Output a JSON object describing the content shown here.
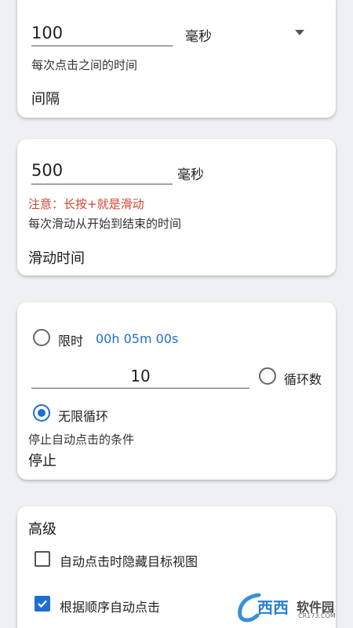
{
  "colors": {
    "accent": "#1e6fd0",
    "warning": "#d2452f",
    "background": "#eef0f4",
    "card": "#ffffff"
  },
  "interval": {
    "value": "100",
    "unit": "毫秒",
    "hint": "每次点击之间的时间",
    "title": "间隔"
  },
  "swipe": {
    "value": "500",
    "unit": "毫秒",
    "warning": "注意：长按+就是滑动",
    "hint": "每次滑动从开始到结束的时间",
    "title": "滑动时间"
  },
  "stop": {
    "time_limit_label": "限时",
    "time_limit_value": "00h 05m 00s",
    "loop_count_value": "10",
    "loop_count_label": "循环数",
    "infinite_label": "无限循环",
    "hint": "停止自动点击的条件",
    "title": "停止",
    "selected": "infinite"
  },
  "advanced": {
    "title": "高级",
    "options": [
      {
        "label": "自动点击时隐藏目标视图",
        "checked": false
      },
      {
        "label": "根据顺序自动点击",
        "checked": true
      }
    ]
  },
  "watermark": {
    "brand": "西西",
    "text": "软件园",
    "site": "CR173.COM"
  }
}
